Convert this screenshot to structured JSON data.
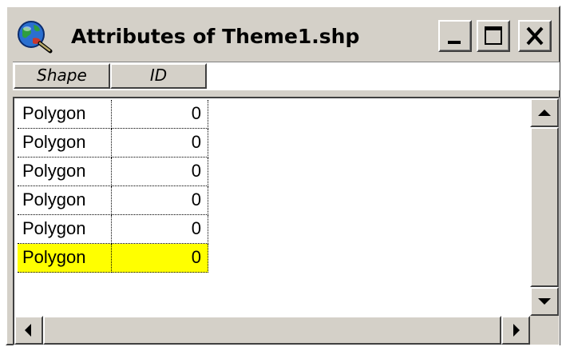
{
  "window": {
    "title": "Attributes of Theme1.shp",
    "icon": "globe-magnifier-icon"
  },
  "titlebar_buttons": [
    {
      "name": "minimize",
      "icon": "minimize-icon"
    },
    {
      "name": "maximize",
      "icon": "maximize-icon"
    },
    {
      "name": "close",
      "icon": "close-icon"
    }
  ],
  "table": {
    "columns": [
      "Shape",
      "ID"
    ],
    "rows": [
      {
        "shape": "Polygon",
        "id": "0"
      },
      {
        "shape": "Polygon",
        "id": "0"
      },
      {
        "shape": "Polygon",
        "id": "0"
      },
      {
        "shape": "Polygon",
        "id": "0"
      },
      {
        "shape": "Polygon",
        "id": "0"
      },
      {
        "shape": "Polygon",
        "id": "0",
        "selected": true
      }
    ],
    "selected_row_color": "#ffff00"
  },
  "scrollbars": {
    "vertical": {
      "up": "arrow-up-icon",
      "down": "arrow-down-icon"
    },
    "horizontal": {
      "left": "arrow-left-icon",
      "right": "arrow-right-icon"
    }
  },
  "colors": {
    "face": "#d4d0c8",
    "selection": "#ffff00"
  }
}
